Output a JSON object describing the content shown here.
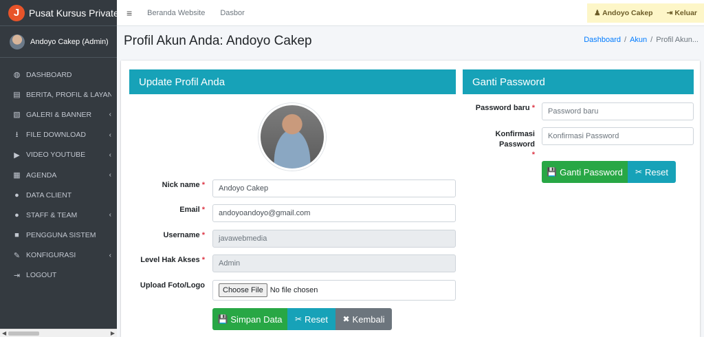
{
  "brand": {
    "logo_letter": "J",
    "title": "Pusat Kursus Private Web"
  },
  "user": {
    "name": "Andoyo Cakep (Admin)"
  },
  "sidebar": {
    "items": [
      {
        "label": "DASHBOARD",
        "icon": "tachometer-icon",
        "glyph": "◍",
        "has_chevron": false
      },
      {
        "label": "BERITA, PROFIL & LAYANAN",
        "icon": "newspaper-icon",
        "glyph": "▤",
        "has_chevron": false
      },
      {
        "label": "GALERI & BANNER",
        "icon": "image-icon",
        "glyph": "▧",
        "has_chevron": true
      },
      {
        "label": "FILE DOWNLOAD",
        "icon": "download-icon",
        "glyph": "⭳",
        "has_chevron": true
      },
      {
        "label": "VIDEO YOUTUBE",
        "icon": "video-icon",
        "glyph": "▶",
        "has_chevron": true
      },
      {
        "label": "AGENDA",
        "icon": "calendar-icon",
        "glyph": "▦",
        "has_chevron": true
      },
      {
        "label": "DATA CLIENT",
        "icon": "users-icon",
        "glyph": "●",
        "has_chevron": false
      },
      {
        "label": "STAFF & TEAM",
        "icon": "users-icon",
        "glyph": "●",
        "has_chevron": true
      },
      {
        "label": "PENGGUNA SISTEM",
        "icon": "lock-icon",
        "glyph": "■",
        "has_chevron": false
      },
      {
        "label": "KONFIGURASI",
        "icon": "wrench-icon",
        "glyph": "✎",
        "has_chevron": true
      },
      {
        "label": "LOGOUT",
        "icon": "sign-out-icon",
        "glyph": "⇥",
        "has_chevron": false
      }
    ],
    "chevron": "‹"
  },
  "topbar": {
    "menu_icon": "≡",
    "links": [
      "Beranda Website",
      "Dasbor"
    ],
    "user_button": "Andoyo Cakep",
    "logout_button": "Keluar",
    "user_glyph": "♟",
    "logout_glyph": "⇥"
  },
  "page": {
    "title": "Profil Akun Anda: Andoyo Cakep",
    "breadcrumb": [
      "Dashboard",
      "Akun",
      "Profil Akun..."
    ]
  },
  "profile_form": {
    "heading": "Update Profil Anda",
    "fields": {
      "nickname": {
        "label": "Nick name",
        "value": "Andoyo Cakep"
      },
      "email": {
        "label": "Email",
        "value": "andoyoandoyo@gmail.com"
      },
      "username": {
        "label": "Username",
        "value": "javawebmedia"
      },
      "level": {
        "label": "Level Hak Akses",
        "value": "Admin"
      },
      "upload": {
        "label": "Upload Foto/Logo",
        "button": "Choose File",
        "status": "No file chosen"
      }
    },
    "buttons": {
      "save": "Simpan Data",
      "reset": "Reset",
      "back": "Kembali"
    }
  },
  "password_form": {
    "heading": "Ganti Password",
    "fields": {
      "new": {
        "label": "Password baru",
        "placeholder": "Password baru"
      },
      "confirm": {
        "label": "Konfirmasi Password",
        "placeholder": "Konfirmasi Password"
      }
    },
    "buttons": {
      "change": "Ganti Password",
      "reset": "Reset"
    }
  },
  "required_marker": "*",
  "icons": {
    "save": "💾",
    "scissors": "✂",
    "close": "✖"
  },
  "colors": {
    "primary": "#17a2b8",
    "success": "#28a745",
    "secondary": "#6c757d",
    "sidebar": "#343a40",
    "logout_bg": "#fdf6c8"
  }
}
